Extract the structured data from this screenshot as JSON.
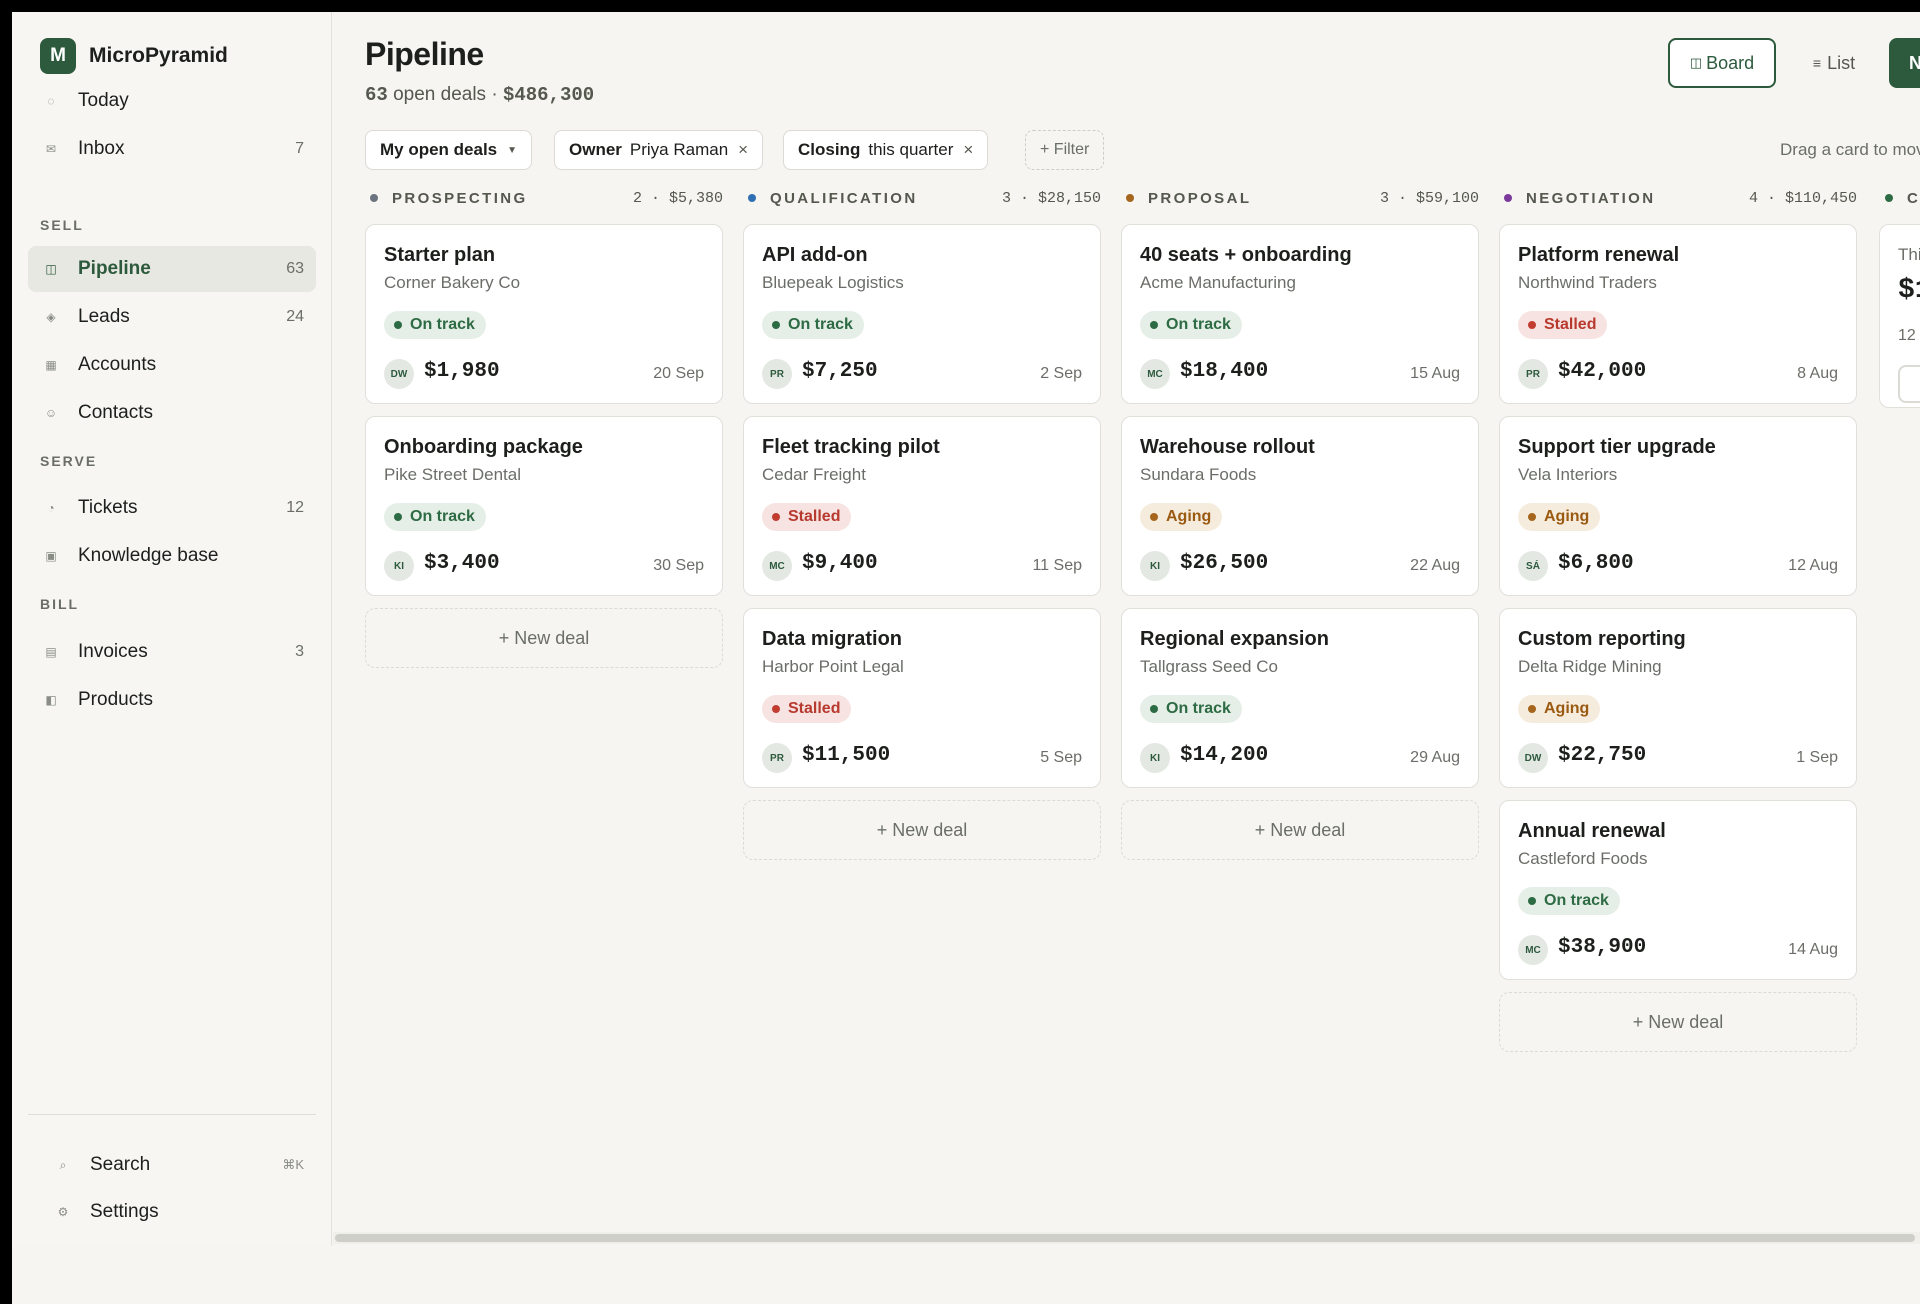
{
  "app": {
    "logo_letter": "M",
    "name": "MicroPyramid"
  },
  "nav": {
    "top": [
      {
        "icon": "today-icon",
        "glyph": "◌",
        "label": "Today",
        "count": ""
      },
      {
        "icon": "inbox-icon",
        "glyph": "✉",
        "label": "Inbox",
        "count": "7"
      }
    ],
    "sell_label": "SELL",
    "sell": [
      {
        "icon": "pipeline-icon",
        "glyph": "◫",
        "label": "Pipeline",
        "count": "63"
      },
      {
        "icon": "leads-icon",
        "glyph": "◈",
        "label": "Leads",
        "count": "24"
      },
      {
        "icon": "accounts-icon",
        "glyph": "▦",
        "label": "Accounts",
        "count": ""
      },
      {
        "icon": "contacts-icon",
        "glyph": "☺",
        "label": "Contacts",
        "count": ""
      }
    ],
    "serve_label": "SERVE",
    "serve": [
      {
        "icon": "tickets-icon",
        "glyph": "◔",
        "label": "Tickets",
        "count": "12"
      },
      {
        "icon": "knowledge-icon",
        "glyph": "▣",
        "label": "Knowledge base",
        "count": ""
      }
    ],
    "bill_label": "BILL",
    "bill": [
      {
        "icon": "invoices-icon",
        "glyph": "▤",
        "label": "Invoices",
        "count": "3"
      },
      {
        "icon": "products-icon",
        "glyph": "◧",
        "label": "Products",
        "count": ""
      }
    ],
    "search": {
      "label": "Search",
      "shortcut": "⌘K"
    },
    "settings": {
      "label": "Settings"
    }
  },
  "header": {
    "title": "Pipeline",
    "deals_count": "63",
    "deals_text": "open deals ·",
    "total": "$486,300",
    "board": "Board",
    "list": "List",
    "new_button": "N"
  },
  "filters": {
    "view": "My open deals",
    "owner_key": "Owner",
    "owner_val": "Priya Raman",
    "closing_key": "Closing",
    "closing_val": "this quarter",
    "add": "+ Filter",
    "hint": "Drag a card to move"
  },
  "colors": {
    "accent": "#2d5a3d",
    "prospecting": "#6b7280",
    "qualification": "#2f6fb3",
    "proposal": "#a5651c",
    "negotiation": "#7a3a9c",
    "closing": "#2d6b44"
  },
  "columns": [
    {
      "name": "PROSPECTING",
      "meta": "2 · $5,380",
      "new": "+ New deal",
      "cards": [
        {
          "title": "Starter plan",
          "company": "Corner Bakery Co",
          "status": "on",
          "status_label": "On track",
          "avatar": "DW",
          "amount": "$1,980",
          "date": "20 Sep"
        },
        {
          "title": "Onboarding package",
          "company": "Pike Street Dental",
          "status": "on",
          "status_label": "On track",
          "avatar": "KI",
          "amount": "$3,400",
          "date": "30 Sep"
        }
      ]
    },
    {
      "name": "QUALIFICATION",
      "meta": "3 · $28,150",
      "new": "+ New deal",
      "cards": [
        {
          "title": "API add-on",
          "company": "Bluepeak Logistics",
          "status": "on",
          "status_label": "On track",
          "avatar": "PR",
          "amount": "$7,250",
          "date": "2 Sep"
        },
        {
          "title": "Fleet tracking pilot",
          "company": "Cedar Freight",
          "status": "st",
          "status_label": "Stalled",
          "avatar": "MC",
          "amount": "$9,400",
          "date": "11 Sep"
        },
        {
          "title": "Data migration",
          "company": "Harbor Point Legal",
          "status": "st",
          "status_label": "Stalled",
          "avatar": "PR",
          "amount": "$11,500",
          "date": "5 Sep"
        }
      ]
    },
    {
      "name": "PROPOSAL",
      "meta": "3 · $59,100",
      "new": "+ New deal",
      "cards": [
        {
          "title": "40 seats + onboarding",
          "company": "Acme Manufacturing",
          "status": "on",
          "status_label": "On track",
          "avatar": "MC",
          "amount": "$18,400",
          "date": "15 Aug"
        },
        {
          "title": "Warehouse rollout",
          "company": "Sundara Foods",
          "status": "ag",
          "status_label": "Aging",
          "avatar": "KI",
          "amount": "$26,500",
          "date": "22 Aug"
        },
        {
          "title": "Regional expansion",
          "company": "Tallgrass Seed Co",
          "status": "on",
          "status_label": "On track",
          "avatar": "KI",
          "amount": "$14,200",
          "date": "29 Aug"
        }
      ]
    },
    {
      "name": "NEGOTIATION",
      "meta": "4 · $110,450",
      "new": "+ New deal",
      "cards": [
        {
          "title": "Platform renewal",
          "company": "Northwind Traders",
          "status": "st",
          "status_label": "Stalled",
          "avatar": "PR",
          "amount": "$42,000",
          "date": "8 Aug"
        },
        {
          "title": "Support tier upgrade",
          "company": "Vela Interiors",
          "status": "ag",
          "status_label": "Aging",
          "avatar": "SÁ",
          "amount": "$6,800",
          "date": "12 Aug"
        },
        {
          "title": "Custom reporting",
          "company": "Delta Ridge Mining",
          "status": "ag",
          "status_label": "Aging",
          "avatar": "DW",
          "amount": "$22,750",
          "date": "1 Sep"
        },
        {
          "title": "Annual renewal",
          "company": "Castleford Foods",
          "status": "on",
          "status_label": "On track",
          "avatar": "MC",
          "amount": "$38,900",
          "date": "14 Aug"
        }
      ]
    }
  ],
  "peek": {
    "name": "CL",
    "line1": "Thi",
    "amount": "$1",
    "line3": "12"
  }
}
